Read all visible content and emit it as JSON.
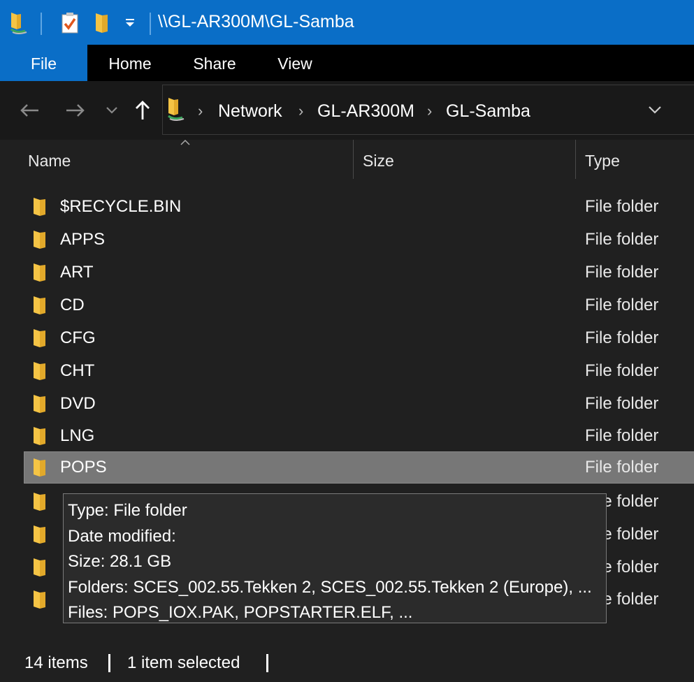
{
  "window": {
    "title": "\\\\GL-AR300M\\GL-Samba",
    "quick_access": [
      "network-drive-icon",
      "properties-icon",
      "new-folder-icon",
      "customize-dropdown-icon"
    ]
  },
  "ribbon": {
    "tabs": [
      "File",
      "Home",
      "Share",
      "View"
    ]
  },
  "address": {
    "breadcrumbs": [
      "Network",
      "GL-AR300M",
      "GL-Samba"
    ]
  },
  "columns": {
    "name": "Name",
    "size": "Size",
    "type": "Type",
    "sort_indicator": "^"
  },
  "files": [
    {
      "name": "$RECYCLE.BIN",
      "type": "File folder"
    },
    {
      "name": "APPS",
      "type": "File folder"
    },
    {
      "name": "ART",
      "type": "File folder"
    },
    {
      "name": "CD",
      "type": "File folder"
    },
    {
      "name": "CFG",
      "type": "File folder"
    },
    {
      "name": "CHT",
      "type": "File folder"
    },
    {
      "name": "DVD",
      "type": "File folder"
    },
    {
      "name": "LNG",
      "type": "File folder"
    },
    {
      "name": "POPS",
      "type": "File folder",
      "selected": true
    },
    {
      "name": "",
      "type": "File folder"
    },
    {
      "name": "",
      "type": "File folder"
    },
    {
      "name": "",
      "type": "File folder"
    },
    {
      "name": "",
      "type": "File folder"
    }
  ],
  "tooltip": {
    "lines": [
      "Type: File folder",
      "Date modified:",
      "Size: 28.1 GB",
      "Folders: SCES_002.55.Tekken 2, SCES_002.55.Tekken 2 (Europe), ...",
      "Files: POPS_IOX.PAK, POPSTARTER.ELF, ..."
    ]
  },
  "status": {
    "item_count": "14 items",
    "selection": "1 item selected"
  },
  "colors": {
    "accent": "#0a6ec7",
    "folder": "#f5c445",
    "selected_row": "#777777",
    "background": "#202020"
  }
}
